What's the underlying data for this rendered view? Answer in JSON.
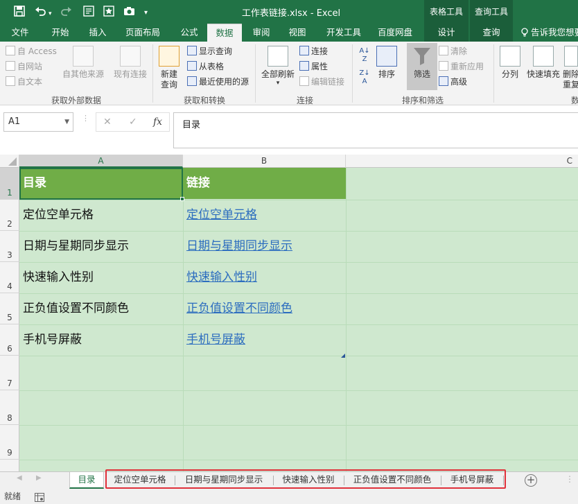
{
  "titlebar": {
    "title": "工作表链接.xlsx - Excel",
    "context_groups": [
      "表格工具",
      "查询工具"
    ],
    "save_icon": "save-icon",
    "undo_icon": "undo-icon",
    "redo_icon": "redo-icon"
  },
  "tabs": [
    "文件",
    "开始",
    "插入",
    "页面布局",
    "公式",
    "数据",
    "审阅",
    "视图",
    "开发工具",
    "百度网盘",
    "设计",
    "查询"
  ],
  "tell_me": "告诉我您想要",
  "ribbon": {
    "get_external": {
      "label": "获取外部数据",
      "access": "自 Access",
      "web": "自网站",
      "text": "自文本",
      "other": "自其他来源",
      "existing": "现有连接"
    },
    "get_transform": {
      "label": "获取和转换",
      "new_query": "新建查询",
      "show_query": "显示查询",
      "from_table": "从表格",
      "recent": "最近使用的源"
    },
    "connections": {
      "label": "连接",
      "refresh_all": "全部刷新",
      "connections": "连接",
      "properties": "属性",
      "edit_links": "编辑链接"
    },
    "sort_filter": {
      "label": "排序和筛选",
      "sort": "排序",
      "filter": "筛选",
      "clear": "清除",
      "reapply": "重新应用",
      "advanced": "高级"
    },
    "data_tools": {
      "label": "数",
      "split": "分列",
      "flash_fill": "快速填充",
      "remove_dup_1": "删除",
      "remove_dup_2": "重复"
    }
  },
  "formula_bar": {
    "name_box": "A1",
    "cancel": "✕",
    "enter": "✓",
    "fx": "fx",
    "content": "目录"
  },
  "columns": [
    "A",
    "B",
    "C"
  ],
  "rows": [
    "1",
    "2",
    "3",
    "4",
    "5",
    "6",
    "7",
    "8",
    "9"
  ],
  "table": {
    "headers": [
      "目录",
      "链接"
    ],
    "rows": [
      [
        "定位空单元格",
        "定位空单元格"
      ],
      [
        "日期与星期同步显示",
        "日期与星期同步显示"
      ],
      [
        "快速输入性别",
        "快速输入性别"
      ],
      [
        "正负值设置不同颜色",
        "正负值设置不同颜色"
      ],
      [
        "手机号屏蔽",
        "手机号屏蔽"
      ]
    ]
  },
  "sheet_tabs": [
    "目录",
    "定位空单元格",
    "日期与星期同步显示",
    "快速输入性别",
    "正负值设置不同颜色",
    "手机号屏蔽"
  ],
  "status": {
    "ready": "就绪"
  },
  "colors": {
    "excel_green": "#217346",
    "header_fill": "#70ad47",
    "sheet_bg": "#cfe8cf",
    "link": "#2c6dbf",
    "highlight_box": "#e0303a"
  }
}
